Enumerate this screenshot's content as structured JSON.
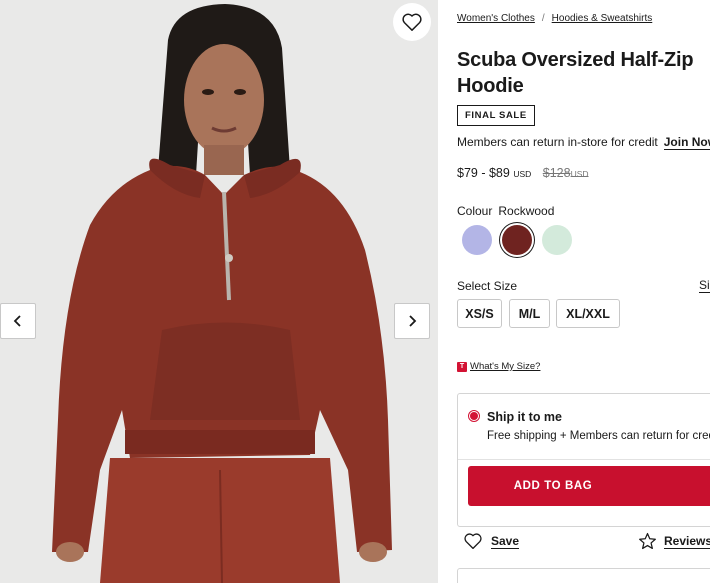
{
  "gallery": {
    "image_alt": "Model wearing Scuba Oversized Half-Zip Hoodie in Rockwood",
    "wishlist_icon": "heart-outline-icon",
    "prev_icon": "chevron-left-icon",
    "next_icon": "chevron-right-icon"
  },
  "breadcrumb": {
    "items": [
      "Women's Clothes",
      "Hoodies & Sweatshirts"
    ],
    "separator": "/"
  },
  "product": {
    "title_line1": "Scuba Oversized Half-Zip",
    "title_line2": "Hoodie",
    "badge": "FINAL SALE",
    "members_text": "Members can return in-store for credit",
    "join_label": "Join Now",
    "price_range": "$79 - $89",
    "currency": "USD",
    "was_price": "$128",
    "was_currency": "USD"
  },
  "colour": {
    "label": "Colour",
    "selected_name": "Rockwood",
    "swatches": [
      {
        "color": "#b3b5e6",
        "selected": false
      },
      {
        "color": "#6f2320",
        "selected": true
      },
      {
        "color": "#d3eadb",
        "selected": false
      }
    ]
  },
  "size": {
    "label": "Select Size",
    "guide_label": "Size Guide",
    "options": [
      "XS/S",
      "M/L",
      "XL/XXL"
    ],
    "whats_my_size": "What's My Size?",
    "whats_badge": "T"
  },
  "shipping": {
    "title": "Ship it to me",
    "subtitle": "Free shipping + Members can return for credit",
    "add_to_bag": "ADD TO BAG"
  },
  "actions": {
    "save_label": "Save",
    "reviews_label": "Reviews"
  },
  "colors": {
    "accent_red": "#c8102e",
    "hoodie": "#8a3326",
    "background": "#e9e9e8"
  }
}
